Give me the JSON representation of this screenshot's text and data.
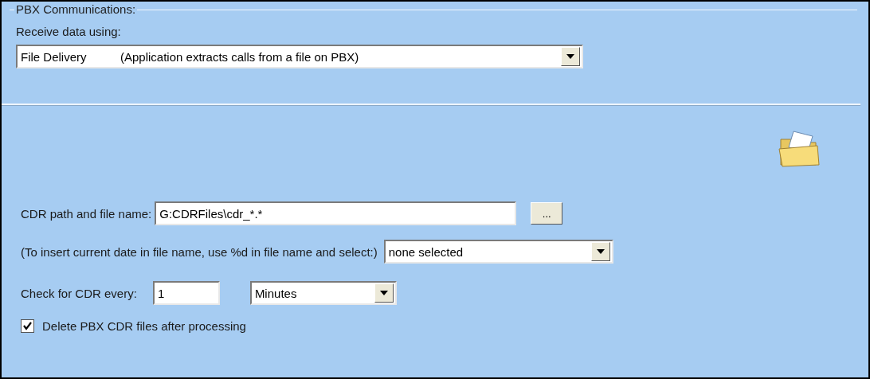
{
  "group_title": "PBX Communications:",
  "receive": {
    "label": "Receive data using:",
    "value": "File Delivery",
    "description": "(Application extracts calls from a file on PBX)"
  },
  "cdr_path": {
    "label": "CDR path and file name:",
    "value": "G:CDRFiles\\cdr_*.*",
    "browse": "..."
  },
  "date_insert": {
    "label": "(To insert current date in file name, use %d in file name and select:)",
    "value": "none selected"
  },
  "check_every": {
    "label": "Check for CDR every:",
    "value": "1",
    "unit": "Minutes"
  },
  "delete_files": {
    "label": "Delete PBX CDR files after processing",
    "checked": true
  }
}
